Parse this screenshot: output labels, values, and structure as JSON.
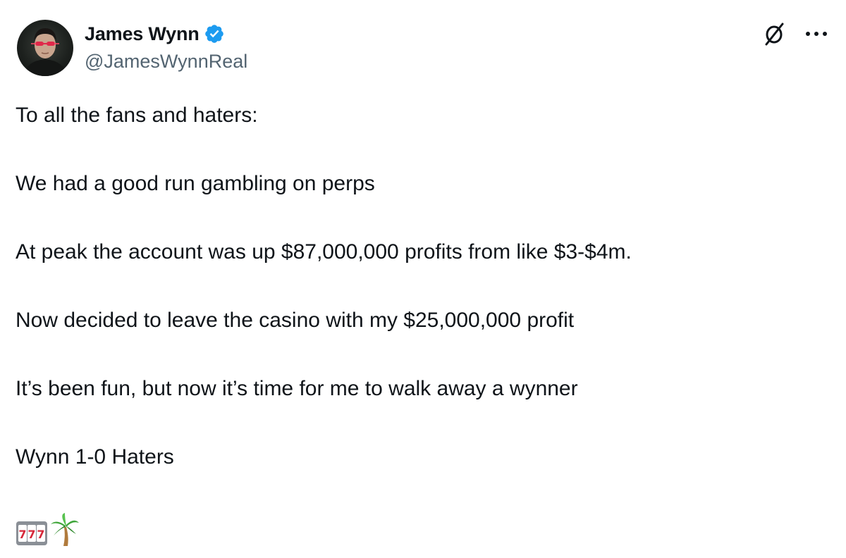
{
  "author": {
    "display_name": "James Wynn",
    "handle": "@JamesWynnReal",
    "verified": true
  },
  "header_actions": {
    "grok_icon": "grok-icon",
    "more_icon": "more-icon"
  },
  "tweet": {
    "paragraphs": [
      "To all the fans and haters:",
      "We had a good run gambling on perps",
      "At peak the account was up $87,000,000 profits from like $3-$4m.",
      "Now decided to leave the casino with my $25,000,000 profit",
      "It’s been fun, but now it’s time for me to walk away a wynner",
      "Wynn 1-0 Haters"
    ],
    "emojis": [
      "slot-machine-emoji",
      "palm-tree-emoji"
    ]
  },
  "colors": {
    "text": "#0f1419",
    "secondary": "#536471",
    "verified": "#1d9bf0"
  }
}
